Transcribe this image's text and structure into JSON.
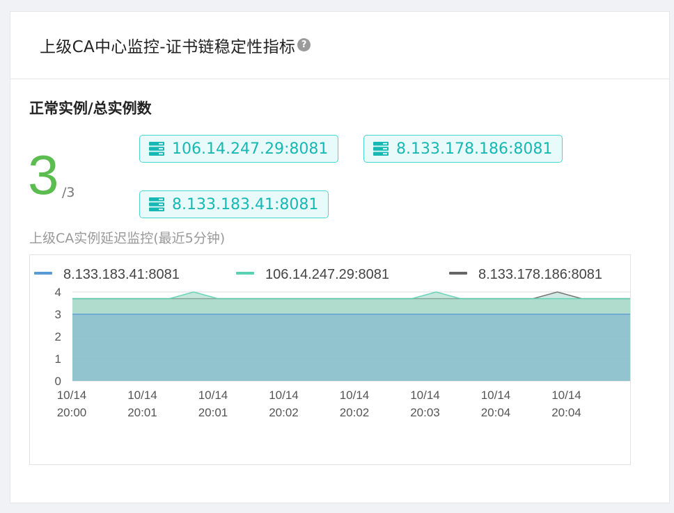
{
  "header": {
    "title": "上级CA中心监控-证书链稳定性指标",
    "help_icon": "question-circle-icon"
  },
  "summary": {
    "section_title": "正常实例/总实例数",
    "healthy_count": "3",
    "total_count": "/3",
    "count_color": "#5bbd4f"
  },
  "instances": [
    {
      "label": "106.14.247.29:8081",
      "icon": "server-icon"
    },
    {
      "label": "8.133.178.186:8081",
      "icon": "server-icon"
    },
    {
      "label": "8.133.183.41:8081",
      "icon": "server-icon"
    }
  ],
  "chart_subtitle": "上级CA实例延迟监控(最近5分钟)",
  "chart_data": {
    "type": "area",
    "title": "",
    "xlabel": "",
    "ylabel": "",
    "categories": [
      "10/14 20:00",
      "10/14 20:01",
      "10/14 20:01",
      "10/14 20:02",
      "10/14 20:02",
      "10/14 20:03",
      "10/14 20:04",
      "10/14 20:04"
    ],
    "ylim": [
      0,
      4
    ],
    "yticks": [
      "0",
      "1",
      "2",
      "3",
      "4"
    ],
    "grid": true,
    "legend_position": "top",
    "series": [
      {
        "name": "8.133.183.41:8081",
        "color": "#5b9bd5",
        "values": [
          3,
          3,
          3,
          3,
          3,
          3,
          3,
          3,
          3,
          3,
          3,
          3,
          3,
          3,
          3,
          3,
          3,
          3,
          3,
          3,
          3,
          3,
          3,
          3
        ]
      },
      {
        "name": "106.14.247.29:8081",
        "color": "#5ad1b3",
        "values": [
          3.7,
          3.7,
          3.7,
          3.7,
          3.7,
          4,
          3.7,
          3.7,
          3.7,
          3.7,
          3.7,
          3.7,
          3.7,
          3.7,
          3.7,
          4,
          3.7,
          3.7,
          3.7,
          3.7,
          3.7,
          3.7,
          3.7,
          3.7
        ]
      },
      {
        "name": "8.133.178.186:8081",
        "color": "#666666",
        "values": [
          3.7,
          3.7,
          3.7,
          3.7,
          3.7,
          3.7,
          3.7,
          3.7,
          3.7,
          3.7,
          3.7,
          3.7,
          3.7,
          3.7,
          3.7,
          3.7,
          3.7,
          3.7,
          3.7,
          3.7,
          4,
          3.7,
          3.7,
          3.7
        ]
      }
    ]
  }
}
